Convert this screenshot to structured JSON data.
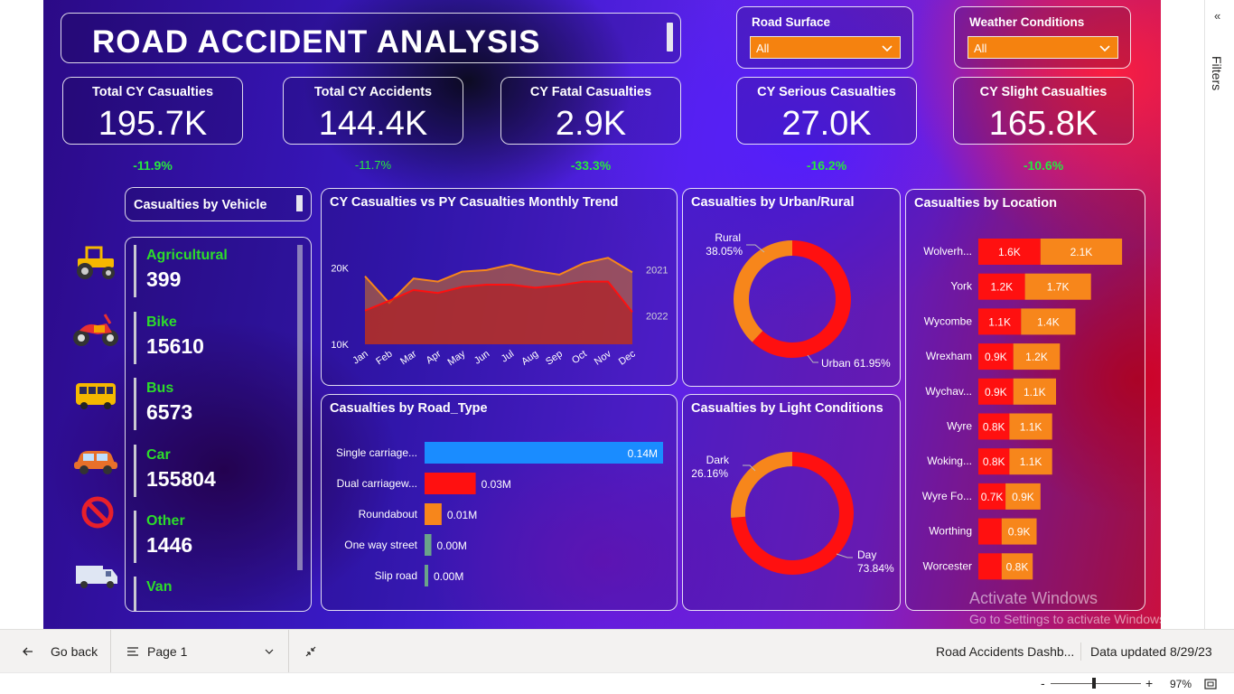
{
  "title": "ROAD ACCIDENT ANALYSIS",
  "slicers": [
    {
      "label": "Road Surface",
      "value": "All"
    },
    {
      "label": "Weather Conditions",
      "value": "All"
    }
  ],
  "kpis": [
    {
      "label": "Total CY Casualties",
      "value": "195.7K",
      "change": "-11.9%"
    },
    {
      "label": "Total CY Accidents",
      "value": "144.4K",
      "change": "-11.7%"
    },
    {
      "label": "CY Fatal Casualties",
      "value": "2.9K",
      "change": "-33.3%"
    },
    {
      "label": "CY Serious Casualties",
      "value": "27.0K",
      "change": "-16.2%"
    },
    {
      "label": "CY Slight Casualties",
      "value": "165.8K",
      "change": "-10.6%"
    }
  ],
  "vehicles": {
    "title": "Casualties by Vehicle",
    "items": [
      {
        "name": "Agricultural",
        "count": "399",
        "icon": "tractor-icon"
      },
      {
        "name": "Bike",
        "count": "15610",
        "icon": "motorbike-icon"
      },
      {
        "name": "Bus",
        "count": "6573",
        "icon": "bus-icon"
      },
      {
        "name": "Car",
        "count": "155804",
        "icon": "car-icon"
      },
      {
        "name": "Other",
        "count": "1446",
        "icon": "no-entry-icon"
      },
      {
        "name": "Van",
        "count": "",
        "icon": "van-icon"
      }
    ]
  },
  "colors": {
    "red": "#ff1010",
    "orange": "#f7861b",
    "blue": "#1a8cff",
    "green": "#2ddc2a",
    "slate": "#6aa38a"
  },
  "chart_data": [
    {
      "id": "trend",
      "type": "area",
      "title": "CY Casualties vs PY Casualties Monthly Trend",
      "categories": [
        "Jan",
        "Feb",
        "Mar",
        "Apr",
        "May",
        "Jun",
        "Jul",
        "Aug",
        "Sep",
        "Oct",
        "Nov",
        "Dec"
      ],
      "y_ticks": [
        "20K",
        "10K"
      ],
      "ylim": [
        10000,
        25000
      ],
      "series": [
        {
          "name": "2021",
          "values": [
            18900,
            15400,
            18600,
            18200,
            19500,
            19700,
            20400,
            19600,
            19100,
            20600,
            21300,
            19400
          ]
        },
        {
          "name": "2022",
          "values": [
            14400,
            15700,
            17100,
            16700,
            17500,
            17800,
            17800,
            17400,
            17700,
            18200,
            18200,
            14200
          ]
        }
      ]
    },
    {
      "id": "road_type",
      "type": "bar",
      "title": "Casualties by Road_Type",
      "categories": [
        "Single carriage...",
        "Dual carriagew...",
        "Roundabout",
        "One way street",
        "Slip road"
      ],
      "values": [
        0.14,
        0.03,
        0.01,
        0.004,
        0.002
      ],
      "labels": [
        "0.14M",
        "0.03M",
        "0.01M",
        "0.00M",
        "0.00M"
      ]
    },
    {
      "id": "urban_rural",
      "type": "pie",
      "title": "Casualties by Urban/Rural",
      "categories": [
        "Urban",
        "Rural"
      ],
      "values": [
        61.95,
        38.05
      ],
      "labels": [
        "Urban 61.95%",
        "Rural",
        "38.05%"
      ]
    },
    {
      "id": "light",
      "type": "pie",
      "title": "Casualties by Light Conditions",
      "categories": [
        "Day",
        "Dark"
      ],
      "values": [
        73.84,
        26.16
      ],
      "labels": [
        "Day",
        "73.84%",
        "Dark",
        "26.16%"
      ]
    },
    {
      "id": "location",
      "type": "bar",
      "title": "Casualties by Location",
      "categories": [
        "Wolverh...",
        "York",
        "Wycombe",
        "Wrexham",
        "Wychav...",
        "Wyre",
        "Woking...",
        "Wyre Fo...",
        "Worthing",
        "Worcester"
      ],
      "series": [
        {
          "name": "seg1",
          "values": [
            1.6,
            1.2,
            1.1,
            0.9,
            0.9,
            0.8,
            0.8,
            0.7,
            0.6,
            0.6
          ],
          "labels": [
            "1.6K",
            "1.2K",
            "1.1K",
            "0.9K",
            "0.9K",
            "0.8K",
            "0.8K",
            "0.7K",
            "",
            ""
          ]
        },
        {
          "name": "seg2",
          "values": [
            2.1,
            1.7,
            1.4,
            1.2,
            1.1,
            1.1,
            1.1,
            0.9,
            0.9,
            0.8
          ],
          "labels": [
            "2.1K",
            "1.7K",
            "1.4K",
            "1.2K",
            "1.1K",
            "1.1K",
            "1.1K",
            "0.9K",
            "0.9K",
            "0.8K"
          ]
        }
      ]
    }
  ],
  "watermark": {
    "line1": "Activate Windows",
    "line2": "Go to Settings to activate Windows."
  },
  "filters_pane": {
    "label": "Filters"
  },
  "bottom_bar": {
    "go_back": "Go back",
    "page": "Page 1",
    "report_name": "Road Accidents Dashb...",
    "updated": "Data updated 8/29/23"
  },
  "status_bar": {
    "zoom": "97%",
    "minus": "-",
    "plus": "+"
  }
}
